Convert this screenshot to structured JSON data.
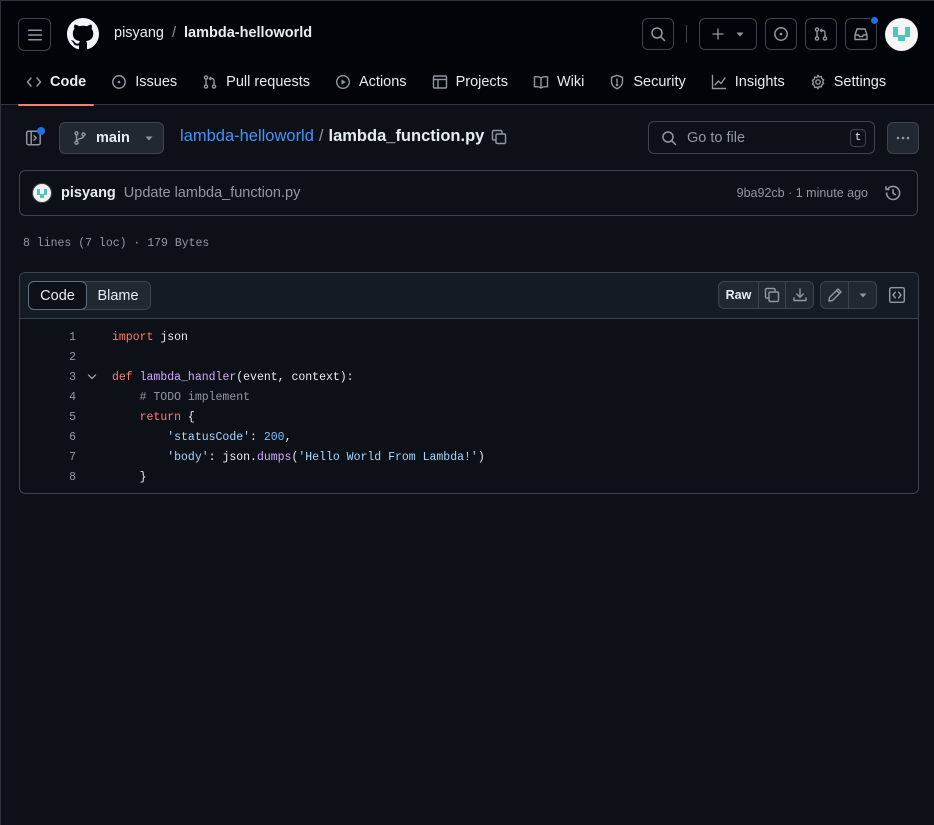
{
  "header": {
    "owner": "pisyang",
    "separator": "/",
    "repo": "lambda-helloworld"
  },
  "nav": [
    {
      "label": "Code",
      "icon": "code-icon"
    },
    {
      "label": "Issues",
      "icon": "issue-opened-icon"
    },
    {
      "label": "Pull requests",
      "icon": "git-pull-request-icon"
    },
    {
      "label": "Actions",
      "icon": "play-icon"
    },
    {
      "label": "Projects",
      "icon": "table-icon"
    },
    {
      "label": "Wiki",
      "icon": "book-icon"
    },
    {
      "label": "Security",
      "icon": "shield-icon"
    },
    {
      "label": "Insights",
      "icon": "graph-icon"
    },
    {
      "label": "Settings",
      "icon": "gear-icon"
    }
  ],
  "file_nav": {
    "branch": "main",
    "repo_link": "lambda-helloworld",
    "separator": "/",
    "file_name": "lambda_function.py",
    "goto_placeholder": "Go to file",
    "goto_shortcut": "t"
  },
  "commit": {
    "author": "pisyang",
    "message": "Update lambda_function.py",
    "meta": "9ba92cb · 1 minute ago"
  },
  "file_info": "8 lines (7 loc) · 179 Bytes",
  "code_toolbar": {
    "tab_code": "Code",
    "tab_blame": "Blame",
    "raw": "Raw"
  },
  "code_lines": [
    {
      "n": "1",
      "text": "import json"
    },
    {
      "n": "2",
      "text": ""
    },
    {
      "n": "3",
      "text": "def lambda_handler(event, context):"
    },
    {
      "n": "4",
      "text": "    # TODO implement"
    },
    {
      "n": "5",
      "text": "    return {"
    },
    {
      "n": "6",
      "text": "        'statusCode': 200,"
    },
    {
      "n": "7",
      "text": "        'body': json.dumps('Hello World From Lambda!')"
    },
    {
      "n": "8",
      "text": "    }"
    }
  ],
  "colors": {
    "background": "#0d1117",
    "accent_underline": "#f78166",
    "link": "#4493f8",
    "keyword": "#ff7b72",
    "function": "#d2a8ff",
    "string": "#a5d6ff",
    "number": "#79c0ff",
    "notification_dot": "#1f6feb"
  }
}
